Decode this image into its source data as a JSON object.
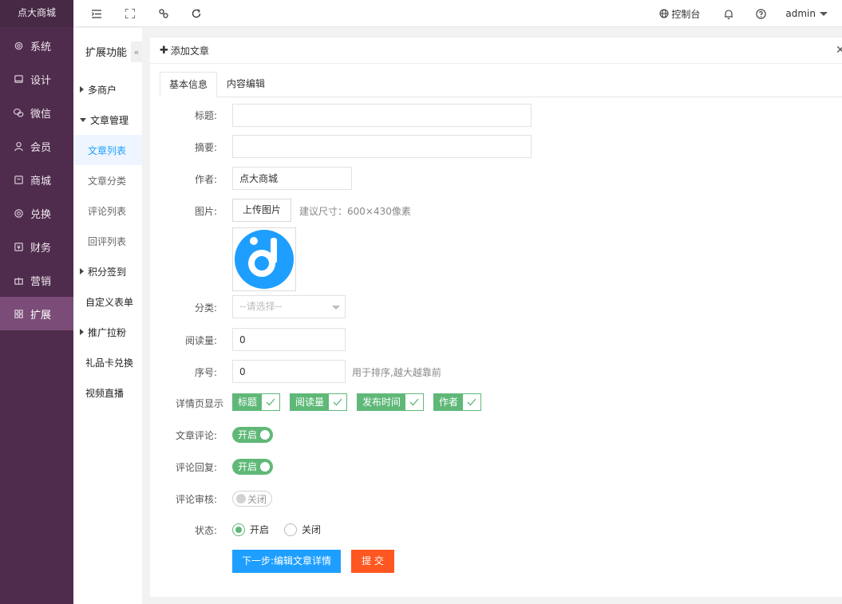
{
  "brand": "点大商城",
  "sidebar": {
    "items": [
      {
        "label": "系统",
        "icon": "gear-icon"
      },
      {
        "label": "设计",
        "icon": "monitor-icon"
      },
      {
        "label": "微信",
        "icon": "wechat-icon"
      },
      {
        "label": "会员",
        "icon": "user-icon"
      },
      {
        "label": "商城",
        "icon": "shop-icon"
      },
      {
        "label": "兑换",
        "icon": "exchange-icon"
      },
      {
        "label": "财务",
        "icon": "finance-icon"
      },
      {
        "label": "营销",
        "icon": "gift-icon"
      },
      {
        "label": "扩展",
        "icon": "apps-icon"
      }
    ],
    "active_index": 8
  },
  "topbar": {
    "console_label": "控制台",
    "user_label": "admin"
  },
  "subnav": {
    "title": "扩展功能",
    "collapse_glyph": "«",
    "multi_merchant": "多商户",
    "article_mgmt": "文章管理",
    "article_list": "文章列表",
    "article_category": "文章分类",
    "comment_list": "评论列表",
    "reply_list": "回评列表",
    "points_signin": "积分签到",
    "custom_form": "自定义表单",
    "promotion": "推广拉粉",
    "gift_card": "礼品卡兑换",
    "live_video": "视频直播"
  },
  "panel": {
    "title": "添加文章",
    "tabs": [
      "基本信息",
      "内容编辑"
    ]
  },
  "form": {
    "title_label": "标题:",
    "title_value": "",
    "summary_label": "摘要:",
    "summary_value": "",
    "author_label": "作者:",
    "author_value": "点大商城",
    "image_label": "图片:",
    "upload_button": "上传图片",
    "upload_hint": "建议尺寸：600×430像素",
    "category_label": "分类:",
    "category_placeholder": "--请选择--",
    "views_label": "阅读量:",
    "views_value": "0",
    "order_label": "序号:",
    "order_value": "0",
    "order_hint": "用于排序,越大越靠前",
    "detail_label": "详情页显示",
    "detail_options": [
      "标题",
      "阅读量",
      "发布时间",
      "作者"
    ],
    "comment_label": "文章评论:",
    "comment_state": "开启",
    "reply_label": "评论回复:",
    "reply_state": "开启",
    "review_label": "评论审核:",
    "review_state": "关闭",
    "status_label": "状态:",
    "status_on": "开启",
    "status_off": "关闭",
    "next_button": "下一步:编辑文章详情",
    "submit_button": "提 交"
  },
  "colors": {
    "sidebar_bg": "#4f2c4d",
    "sidebar_active": "#7b4c78",
    "accent_blue": "#1e9fff",
    "accent_green": "#5fb878",
    "accent_red": "#ff5722"
  }
}
